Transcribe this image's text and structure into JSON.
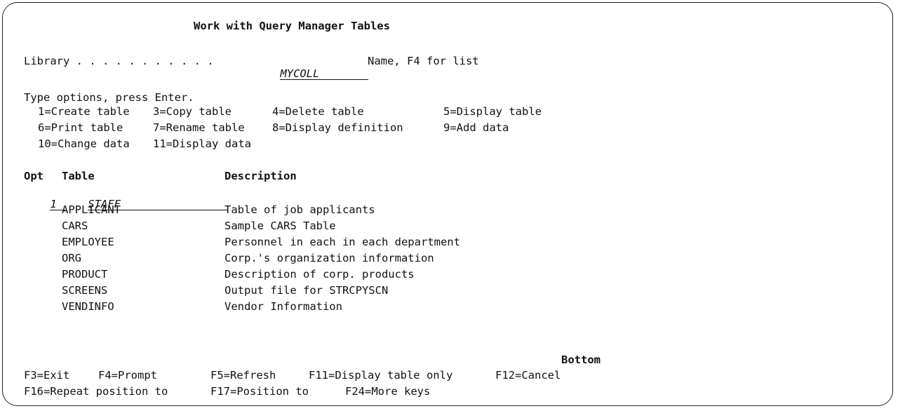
{
  "title": "Work with Query Manager Tables",
  "library": {
    "label": "Library . . . . . . . . . . .",
    "value": "MYCOLL",
    "hint": "Name, F4 for list"
  },
  "instructions": "Type options, press Enter.",
  "options": [
    "1=Create table",
    "3=Copy table",
    "4=Delete table",
    "5=Display table",
    "6=Print table",
    "7=Rename table",
    "8=Display definition",
    "9=Add data",
    "10=Change data",
    "11=Display data"
  ],
  "columns": {
    "opt": "Opt",
    "table": "Table",
    "description": "Description"
  },
  "input_row": {
    "opt": "1",
    "table": "STAFF"
  },
  "rows": [
    {
      "table": "APPLICANT",
      "description": "Table of job applicants"
    },
    {
      "table": "CARS",
      "description": "Sample CARS Table"
    },
    {
      "table": "EMPLOYEE",
      "description": "Personnel in each in each department"
    },
    {
      "table": "ORG",
      "description": "Corp.'s organization information"
    },
    {
      "table": "PRODUCT",
      "description": "Description of corp. products"
    },
    {
      "table": "SCREENS",
      "description": "Output file for STRCPYSCN"
    },
    {
      "table": "VENDINFO",
      "description": "Vendor Information"
    }
  ],
  "more_indicator": "Bottom",
  "function_keys": [
    "F3=Exit",
    "F4=Prompt",
    "F5=Refresh",
    "F11=Display table only",
    "F12=Cancel",
    "F16=Repeat position to",
    "F17=Position to",
    "F24=More keys"
  ]
}
